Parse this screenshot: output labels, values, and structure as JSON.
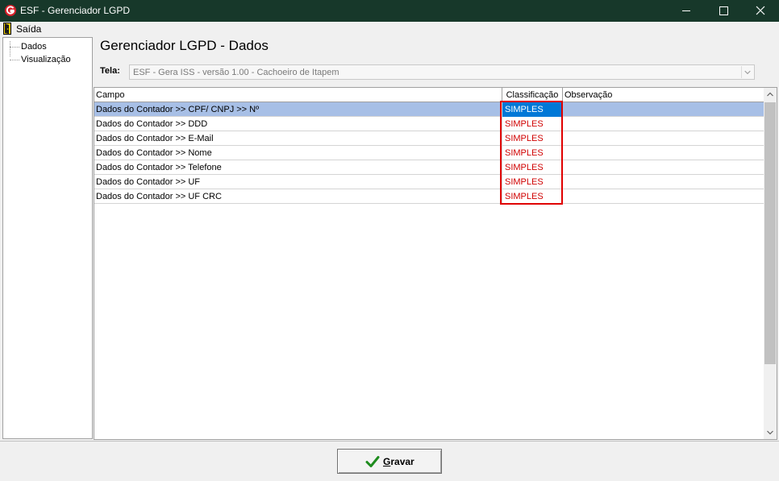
{
  "window": {
    "title": "ESF - Gerenciador LGPD",
    "icon": "esf-logo-icon",
    "controls": [
      "minimize-icon",
      "maximize-icon",
      "close-icon"
    ]
  },
  "menubar": {
    "items": [
      {
        "label": "Saída",
        "icon": "exit-door-icon"
      }
    ]
  },
  "sidebar": {
    "items": [
      {
        "label": "Dados"
      },
      {
        "label": "Visualização"
      }
    ]
  },
  "main": {
    "title": "Gerenciador LGPD - Dados",
    "tela_label": "Tela:",
    "tela_value": "ESF - Gera ISS - versão 1.00 - Cachoeiro de Itapem"
  },
  "grid": {
    "columns": [
      "Campo",
      "Classificação",
      "Observação"
    ],
    "rows": [
      {
        "campo": "Dados do Contador >> CPF/ CNPJ >> Nº",
        "classificacao": "SIMPLES",
        "observacao": "",
        "selected": true
      },
      {
        "campo": "Dados do Contador >> DDD",
        "classificacao": "SIMPLES",
        "observacao": ""
      },
      {
        "campo": "Dados do Contador >> E-Mail",
        "classificacao": "SIMPLES",
        "observacao": ""
      },
      {
        "campo": "Dados do Contador >> Nome",
        "classificacao": "SIMPLES",
        "observacao": ""
      },
      {
        "campo": "Dados do Contador >> Telefone",
        "classificacao": "SIMPLES",
        "observacao": ""
      },
      {
        "campo": "Dados do Contador >> UF",
        "classificacao": "SIMPLES",
        "observacao": ""
      },
      {
        "campo": "Dados do Contador >> UF CRC",
        "classificacao": "SIMPLES",
        "observacao": ""
      }
    ]
  },
  "footer": {
    "save_label": "Gravar",
    "save_mnemonic": "G",
    "save_rest": "ravar",
    "save_icon": "checkmark-icon"
  },
  "colors": {
    "titlebar": "#17382a",
    "classification_text": "#d00000",
    "selected_row": "#a7bfe6",
    "selected_cell": "#0078d7",
    "highlight": "#e00000",
    "check": "#1e8c1e"
  }
}
